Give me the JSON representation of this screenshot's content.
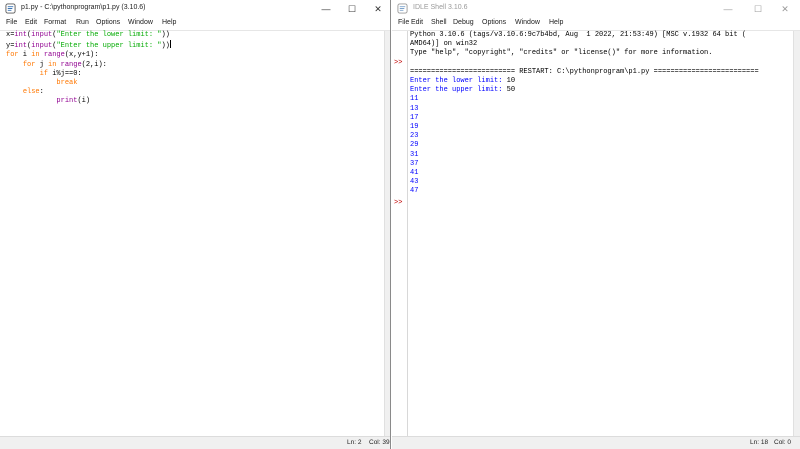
{
  "editor": {
    "title": "p1.py - C:\\pythonprogram\\p1.py (3.10.6)",
    "menu": [
      "File",
      "Edit",
      "Format",
      "Run",
      "Options",
      "Window",
      "Help"
    ],
    "code": {
      "l1": {
        "a": "x=",
        "b": "int",
        "c": "(",
        "d": "input",
        "e": "(",
        "f": "\"Enter the lower limit: \"",
        "g": "))"
      },
      "l2": {
        "a": "y=",
        "b": "int",
        "c": "(",
        "d": "input",
        "e": "(",
        "f": "\"Enter the upper limit: \"",
        "g": "))"
      },
      "l3": {
        "a": "for",
        "b": " i ",
        "c": "in",
        "d": " ",
        "e": "range",
        "f": "(x,y+1):"
      },
      "l4": {
        "indent": "    ",
        "a": "for",
        "b": " j ",
        "c": "in",
        "d": " ",
        "e": "range",
        "f": "(2,i):"
      },
      "l5": {
        "indent": "        ",
        "a": "if",
        "b": " i%j==0:"
      },
      "l6": {
        "indent": "            ",
        "a": "break"
      },
      "l7": {
        "indent": "    ",
        "a": "else",
        ":": ":"
      },
      "l8": {
        "indent": "            ",
        "a": "print",
        "b": "(i)"
      }
    },
    "status": {
      "ln": "Ln: 2",
      "col": "Col: 39"
    },
    "window_buttons": {
      "min": "—",
      "max": "☐",
      "close": "✕"
    }
  },
  "shell": {
    "title": "IDLE Shell 3.10.6",
    "menu": [
      "File",
      "Edit",
      "Shell",
      "Debug",
      "Options",
      "Window",
      "Help"
    ],
    "banner1": "Python 3.10.6 (tags/v3.10.6:9c7b4bd, Aug  1 2022, 21:53:49) [MSC v.1932 64 bit (",
    "banner2": "AMD64)] on win32",
    "banner3": "Type \"help\", \"copyright\", \"credits\" or \"license()\" for more information.",
    "restart": "========================= RESTART: C:\\pythonprogram\\p1.py =========================",
    "prompt1_label": "Enter the lower limit: ",
    "prompt1_value": "10",
    "prompt2_label": "Enter the upper limit: ",
    "prompt2_value": "50",
    "outputs": [
      "11",
      "13",
      "17",
      "19",
      "23",
      "29",
      "31",
      "37",
      "41",
      "43",
      "47"
    ],
    "prompt_symbol": ">>",
    "status": {
      "ln": "Ln: 18",
      "col": "Col: 0"
    },
    "window_buttons": {
      "min": "—",
      "max": "☐",
      "close": "✕"
    }
  },
  "colors": {
    "keyword": "#ff7700",
    "builtin": "#900090",
    "string": "#00aa00",
    "output": "#0000ff",
    "prompt": "#c00000"
  }
}
